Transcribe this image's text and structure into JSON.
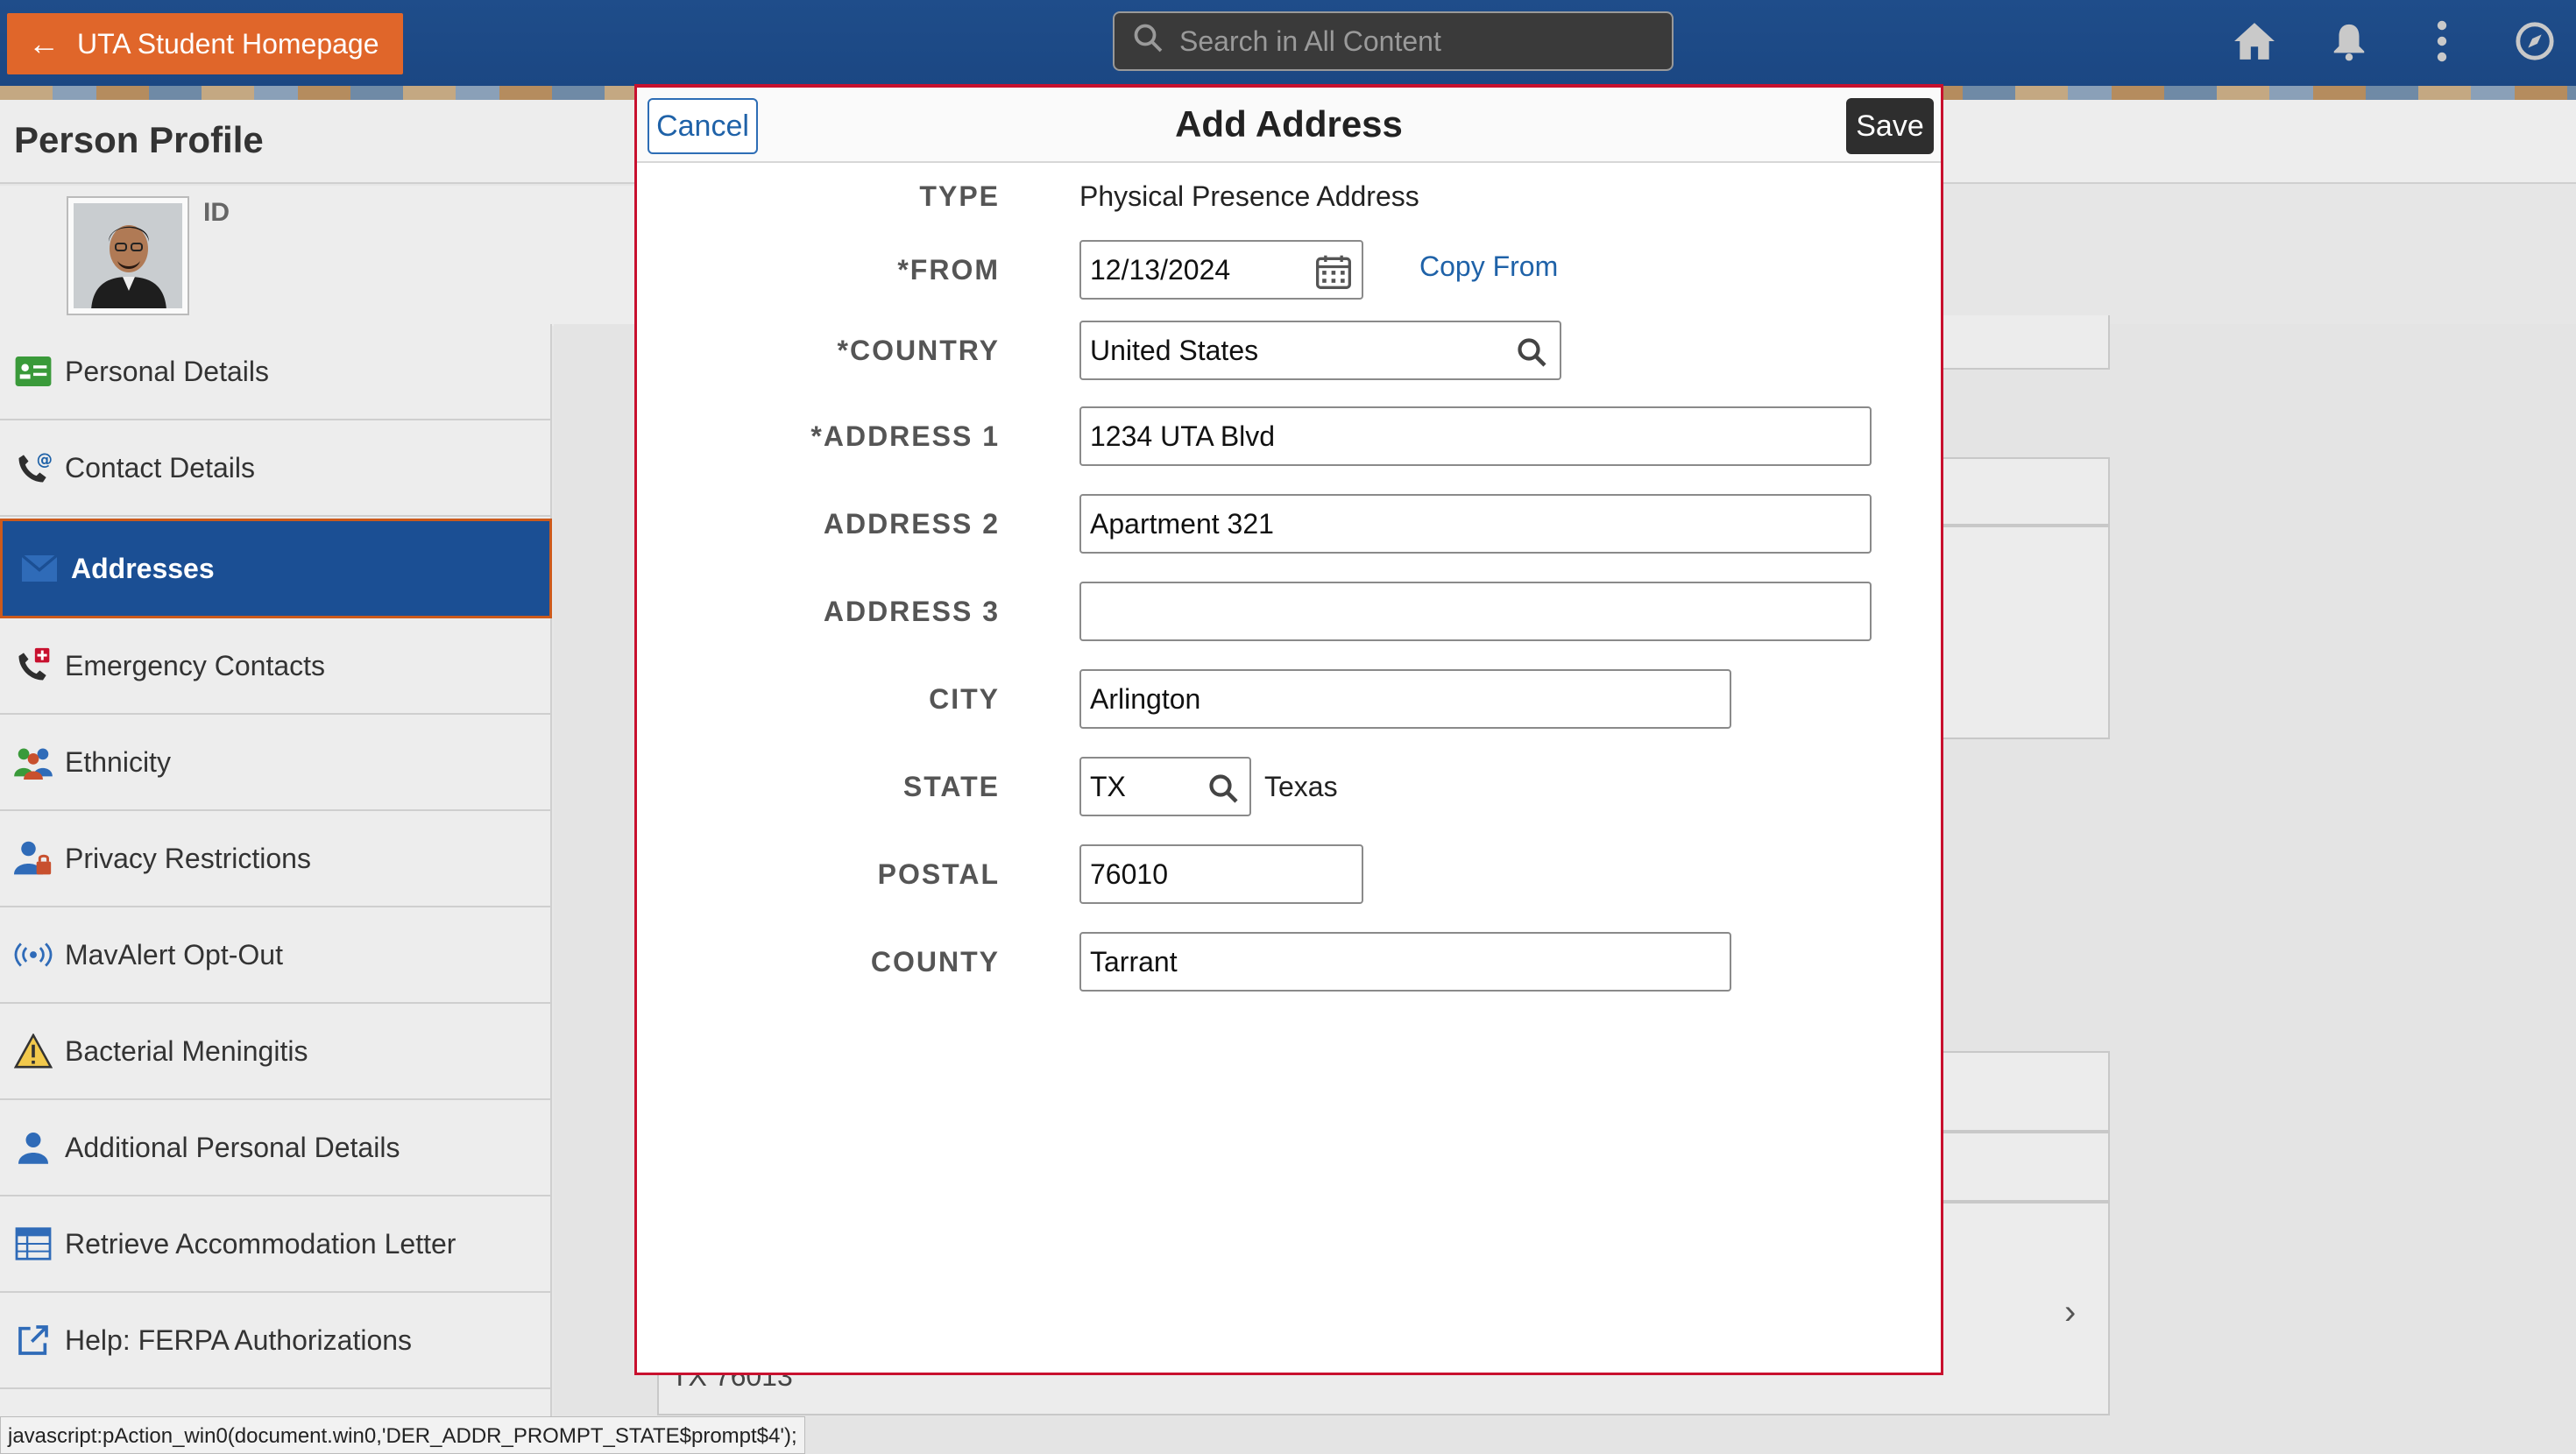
{
  "topbar": {
    "back_label": "UTA Student Homepage",
    "search_placeholder": "Search in All Content"
  },
  "page": {
    "title": "Person Profile",
    "id_label": "ID"
  },
  "sidebar": {
    "items": [
      {
        "label": "Personal Details",
        "icon": "id-card-icon"
      },
      {
        "label": "Contact Details",
        "icon": "phone-at-icon"
      },
      {
        "label": "Addresses",
        "icon": "envelope-icon"
      },
      {
        "label": "Emergency Contacts",
        "icon": "phone-cross-icon"
      },
      {
        "label": "Ethnicity",
        "icon": "people-icon"
      },
      {
        "label": "Privacy Restrictions",
        "icon": "person-lock-icon"
      },
      {
        "label": "MavAlert Opt-Out",
        "icon": "broadcast-icon"
      },
      {
        "label": "Bacterial Meningitis",
        "icon": "warning-icon"
      },
      {
        "label": "Additional Personal Details",
        "icon": "person-icon"
      },
      {
        "label": "Retrieve Accommodation Letter",
        "icon": "table-icon"
      },
      {
        "label": "Help: FERPA Authorizations",
        "icon": "external-link-icon"
      }
    ],
    "active": "Addresses"
  },
  "background": {
    "partial_text": "TX 76013"
  },
  "modal": {
    "title": "Add Address",
    "cancel_label": "Cancel",
    "save_label": "Save",
    "copy_from_label": "Copy From",
    "fields": {
      "type": {
        "label": "TYPE",
        "value": "Physical Presence Address"
      },
      "from": {
        "label": "*FROM",
        "value": "12/13/2024"
      },
      "country": {
        "label": "*COUNTRY",
        "value": "United States"
      },
      "address1": {
        "label": "*ADDRESS 1",
        "value": "1234 UTA Blvd"
      },
      "address2": {
        "label": "ADDRESS 2",
        "value": "Apartment 321"
      },
      "address3": {
        "label": "ADDRESS 3",
        "value": ""
      },
      "city": {
        "label": "CITY",
        "value": "Arlington"
      },
      "state": {
        "label": "STATE",
        "value": "TX",
        "description": "Texas"
      },
      "postal": {
        "label": "POSTAL",
        "value": "76010"
      },
      "county": {
        "label": "COUNTY",
        "value": "Tarrant"
      }
    }
  },
  "statusbar": {
    "text": "javascript:pAction_win0(document.win0,'DER_ADDR_PROMPT_STATE$prompt$4');"
  },
  "colors": {
    "banner": "#1f4d8a",
    "back_button": "#e0662a",
    "active_nav": "#1b4f94",
    "modal_border": "#c8102e",
    "link": "#1f62a8"
  }
}
